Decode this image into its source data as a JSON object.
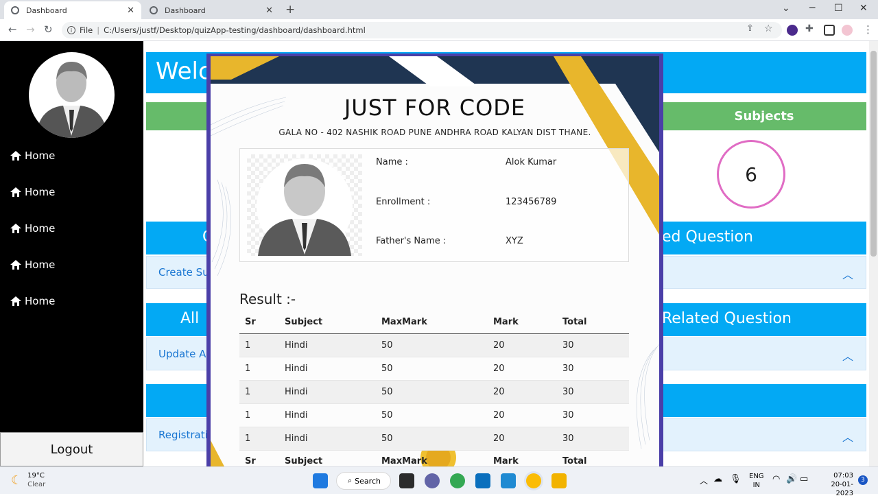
{
  "browser": {
    "tabs": [
      {
        "title": "Dashboard",
        "active": true
      },
      {
        "title": "Dashboard",
        "active": false
      }
    ],
    "url_prefix": "File",
    "url": "C:/Users/justf/Desktop/quizApp-testing/dashboard/dashboard.html"
  },
  "sidebar": {
    "items": [
      {
        "label": "Home"
      },
      {
        "label": "Home"
      },
      {
        "label": "Home"
      },
      {
        "label": "Home"
      },
      {
        "label": "Home"
      }
    ],
    "logout_label": "Logout"
  },
  "main": {
    "welcome_text": "Welc",
    "subjects_label": "Subjects",
    "subjects_count": "6",
    "section1_left": "C",
    "section1_right": "ed Question",
    "section1_link": "Create Su",
    "section2_left": "All",
    "section2_right": "Related Question",
    "section2_link": "Update A",
    "section3_link": "Registrati"
  },
  "card": {
    "title": "JUST FOR CODE",
    "address": "GALA NO - 402 NASHIK ROAD PUNE ANDHRA ROAD KALYAN DIST THANE.",
    "fields": [
      {
        "label": "Name :",
        "value": "Alok Kumar"
      },
      {
        "label": "Enrollment :",
        "value": "123456789"
      },
      {
        "label": "Father's Name :",
        "value": "XYZ"
      }
    ],
    "result_heading": "Result :-",
    "table": {
      "headers": [
        "Sr",
        "Subject",
        "MaxMark",
        "Mark",
        "Total"
      ],
      "rows": [
        [
          "1",
          "Hindi",
          "50",
          "20",
          "30"
        ],
        [
          "1",
          "Hindi",
          "50",
          "20",
          "30"
        ],
        [
          "1",
          "Hindi",
          "50",
          "20",
          "30"
        ],
        [
          "1",
          "Hindi",
          "50",
          "20",
          "30"
        ],
        [
          "1",
          "Hindi",
          "50",
          "20",
          "30"
        ]
      ]
    }
  },
  "taskbar": {
    "weather_temp": "19°C",
    "weather_desc": "Clear",
    "search_label": "Search",
    "lang_line1": "ENG",
    "lang_line2": "IN",
    "time": "07:03",
    "date": "20-01-2023",
    "notification_count": "3"
  },
  "colors": {
    "sidebar_bg": "#000000",
    "header_blue": "#03a9f4",
    "subjects_green": "#66bb6a",
    "circle_pink": "#e06cc4",
    "card_border": "#4b3fa8",
    "card_navy": "#1f3552",
    "card_gold": "#e8b62c"
  }
}
